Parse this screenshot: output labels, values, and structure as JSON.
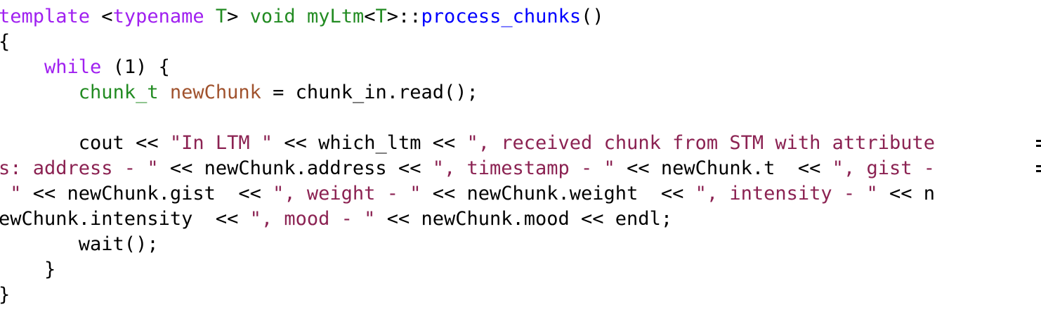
{
  "colors": {
    "keyword": "#a020f0",
    "type": "#228b22",
    "function": "#0000ff",
    "variable": "#a0522d",
    "string": "#8b2252",
    "plain": "#000000",
    "background": "#ffffff"
  },
  "code": {
    "lines": [
      [
        {
          "t": "kw",
          "v": "template"
        },
        {
          "t": "plain",
          "v": " <"
        },
        {
          "t": "kw",
          "v": "typename"
        },
        {
          "t": "plain",
          "v": " "
        },
        {
          "t": "type",
          "v": "T"
        },
        {
          "t": "plain",
          "v": "> "
        },
        {
          "t": "type",
          "v": "void"
        },
        {
          "t": "plain",
          "v": " "
        },
        {
          "t": "type",
          "v": "myLtm"
        },
        {
          "t": "plain",
          "v": "<"
        },
        {
          "t": "type",
          "v": "T"
        },
        {
          "t": "plain",
          "v": ">::"
        },
        {
          "t": "func",
          "v": "process_chunks"
        },
        {
          "t": "plain",
          "v": "()"
        }
      ],
      [
        {
          "t": "plain",
          "v": "{"
        }
      ],
      [
        {
          "t": "plain",
          "v": "    "
        },
        {
          "t": "kw",
          "v": "while"
        },
        {
          "t": "plain",
          "v": " (1) {"
        }
      ],
      [
        {
          "t": "plain",
          "v": "       "
        },
        {
          "t": "type",
          "v": "chunk_t"
        },
        {
          "t": "plain",
          "v": " "
        },
        {
          "t": "var",
          "v": "newChunk"
        },
        {
          "t": "plain",
          "v": " = chunk_in.read();"
        }
      ],
      [],
      [
        {
          "t": "plain",
          "v": "       cout << "
        },
        {
          "t": "str",
          "v": "\"In LTM \""
        },
        {
          "t": "plain",
          "v": " << which_ltm << "
        },
        {
          "t": "str",
          "v": "\", received chunk from STM with attribute"
        }
      ],
      [
        {
          "t": "str",
          "v": "s: address - \""
        },
        {
          "t": "plain",
          "v": " << newChunk.address << "
        },
        {
          "t": "str",
          "v": "\", timestamp - \""
        },
        {
          "t": "plain",
          "v": " << newChunk.t  << "
        },
        {
          "t": "str",
          "v": "\", gist -"
        }
      ],
      [
        {
          "t": "str",
          "v": " \""
        },
        {
          "t": "plain",
          "v": " << newChunk.gist  << "
        },
        {
          "t": "str",
          "v": "\", weight - \""
        },
        {
          "t": "plain",
          "v": " << newChunk.weight  << "
        },
        {
          "t": "str",
          "v": "\", intensity - \""
        },
        {
          "t": "plain",
          "v": " << n"
        }
      ],
      [
        {
          "t": "plain",
          "v": "ewChunk.intensity  << "
        },
        {
          "t": "str",
          "v": "\", mood - \""
        },
        {
          "t": "plain",
          "v": " << newChunk.mood << endl;"
        }
      ],
      [
        {
          "t": "plain",
          "v": "       wait();"
        }
      ],
      [
        {
          "t": "plain",
          "v": "    }"
        }
      ],
      [
        {
          "t": "plain",
          "v": "}"
        }
      ]
    ]
  }
}
